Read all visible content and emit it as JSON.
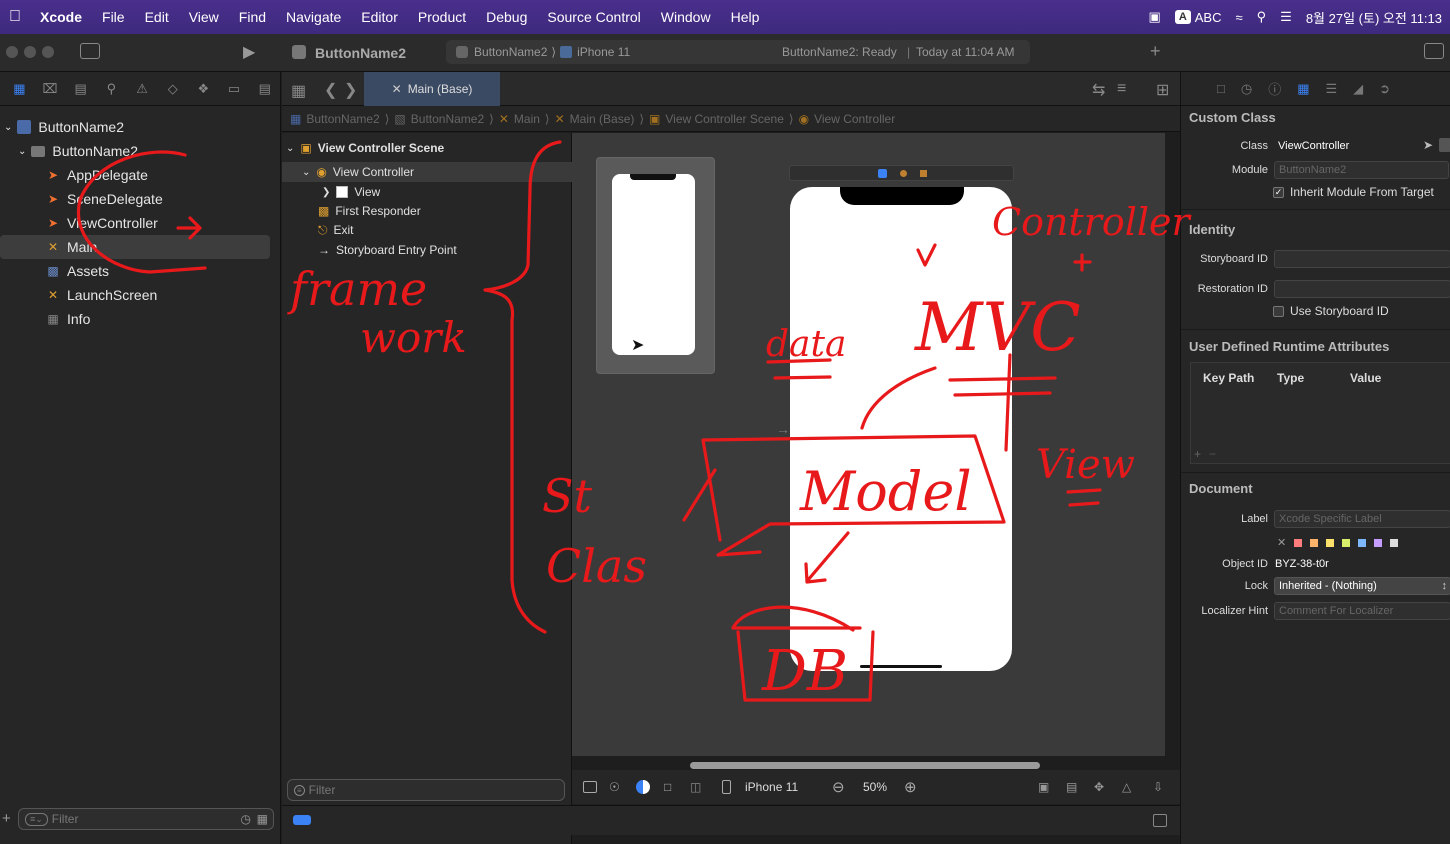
{
  "menubar": {
    "app": "Xcode",
    "items": [
      "File",
      "Edit",
      "View",
      "Find",
      "Navigate",
      "Editor",
      "Product",
      "Debug",
      "Source Control",
      "Window",
      "Help"
    ],
    "input_source": "ABC",
    "datetime": "8월 27일 (토) 오전 11:13"
  },
  "toolbar": {
    "project": "ButtonName2",
    "scheme": "ButtonName2",
    "device": "iPhone 11",
    "status": "ButtonName2: Ready",
    "status_time": "Today at 11:04 AM"
  },
  "navigator": {
    "root": "ButtonName2",
    "group": "ButtonName2",
    "files": [
      "AppDelegate",
      "SceneDelegate",
      "ViewController",
      "Main",
      "Assets",
      "LaunchScreen",
      "Info"
    ],
    "filter_placeholder": "Filter"
  },
  "editor": {
    "tab": "Main (Base)",
    "jump": [
      "ButtonName2",
      "ButtonName2",
      "Main",
      "Main (Base)",
      "View Controller Scene",
      "View Controller"
    ],
    "outline": {
      "scene": "View Controller Scene",
      "vc": "View Controller",
      "view": "View",
      "first_responder": "First Responder",
      "exit": "Exit",
      "entry": "Storyboard Entry Point",
      "filter_placeholder": "Filter"
    },
    "bottom": {
      "device": "iPhone 11",
      "zoom": "50%"
    }
  },
  "inspector": {
    "custom_class": {
      "heading": "Custom Class",
      "class_label": "Class",
      "class_value": "ViewController",
      "module_label": "Module",
      "module_placeholder": "ButtonName2",
      "inherit": "Inherit Module From Target"
    },
    "identity": {
      "heading": "Identity",
      "storyboard_id": "Storyboard ID",
      "restoration_id": "Restoration ID",
      "use_storyboard_id": "Use Storyboard ID"
    },
    "runtime": {
      "heading": "User Defined Runtime Attributes",
      "cols": [
        "Key Path",
        "Type",
        "Value"
      ]
    },
    "document": {
      "heading": "Document",
      "label_label": "Label",
      "label_placeholder": "Xcode Specific Label",
      "object_id_label": "Object ID",
      "object_id": "BYZ-38-t0r",
      "lock_label": "Lock",
      "lock_value": "Inherited - (Nothing)",
      "localizer_label": "Localizer Hint",
      "localizer_placeholder": "Comment For Localizer",
      "swatches": [
        "#ff7d7d",
        "#ffb36b",
        "#ffe26b",
        "#d7ef6b",
        "#7fb7ff",
        "#c59cff",
        "#dddddd"
      ]
    }
  },
  "annotations": {
    "controller": "Controller",
    "framework": "framework",
    "mvc": "MVC",
    "data": "data",
    "model": "Model",
    "view": "View",
    "db": "DB",
    "struct_class": [
      "St",
      "Clas"
    ]
  },
  "colors": {
    "ink": "#e8191b",
    "menubar": "#402c82",
    "selection": "#3b4a63"
  }
}
